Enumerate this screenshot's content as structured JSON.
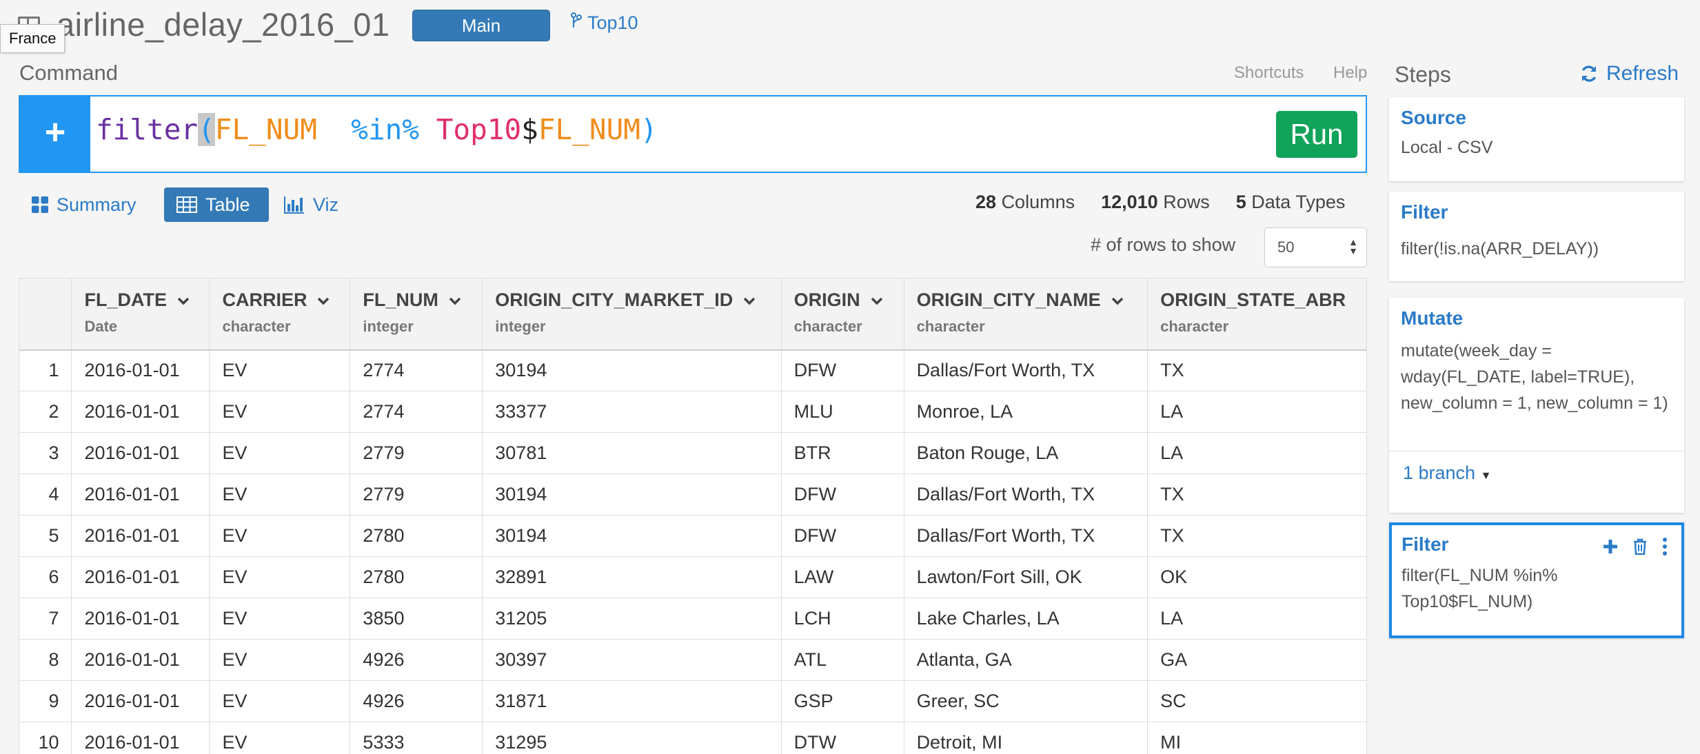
{
  "header": {
    "title": "airline_delay_2016_01",
    "tooltip": "France",
    "main_button": "Main",
    "branch_link": "Top10"
  },
  "command": {
    "label": "Command",
    "shortcuts": "Shortcuts",
    "help": "Help",
    "add_symbol": "+",
    "code": {
      "fn": "filter",
      "open": "(",
      "col1": "FL_NUM",
      "op": "%in%",
      "var": "Top10",
      "dollar": "$",
      "col2": "FL_NUM",
      "close": ")"
    },
    "run": "Run"
  },
  "tabs": [
    {
      "label": "Summary",
      "icon": "grid-icon",
      "active": false
    },
    {
      "label": "Table",
      "icon": "table-icon",
      "active": true
    },
    {
      "label": "Viz",
      "icon": "bar-chart-icon",
      "active": false
    }
  ],
  "stats": {
    "columns_count": "28",
    "columns_label": "Columns",
    "rows_count": "12,010",
    "rows_label": "Rows",
    "types_count": "5",
    "types_label": "Data Types"
  },
  "rows_to_show": {
    "label": "# of rows to show",
    "value": "50"
  },
  "table": {
    "columns": [
      {
        "name": "FL_DATE",
        "type": "Date"
      },
      {
        "name": "CARRIER",
        "type": "character"
      },
      {
        "name": "FL_NUM",
        "type": "integer"
      },
      {
        "name": "ORIGIN_CITY_MARKET_ID",
        "type": "integer"
      },
      {
        "name": "ORIGIN",
        "type": "character"
      },
      {
        "name": "ORIGIN_CITY_NAME",
        "type": "character"
      },
      {
        "name": "ORIGIN_STATE_ABR",
        "type": "character"
      }
    ],
    "rows": [
      [
        "1",
        "2016-01-01",
        "EV",
        "2774",
        "30194",
        "DFW",
        "Dallas/Fort Worth, TX",
        "TX"
      ],
      [
        "2",
        "2016-01-01",
        "EV",
        "2774",
        "33377",
        "MLU",
        "Monroe, LA",
        "LA"
      ],
      [
        "3",
        "2016-01-01",
        "EV",
        "2779",
        "30781",
        "BTR",
        "Baton Rouge, LA",
        "LA"
      ],
      [
        "4",
        "2016-01-01",
        "EV",
        "2779",
        "30194",
        "DFW",
        "Dallas/Fort Worth, TX",
        "TX"
      ],
      [
        "5",
        "2016-01-01",
        "EV",
        "2780",
        "30194",
        "DFW",
        "Dallas/Fort Worth, TX",
        "TX"
      ],
      [
        "6",
        "2016-01-01",
        "EV",
        "2780",
        "32891",
        "LAW",
        "Lawton/Fort Sill, OK",
        "OK"
      ],
      [
        "7",
        "2016-01-01",
        "EV",
        "3850",
        "31205",
        "LCH",
        "Lake Charles, LA",
        "LA"
      ],
      [
        "8",
        "2016-01-01",
        "EV",
        "4926",
        "30397",
        "ATL",
        "Atlanta, GA",
        "GA"
      ],
      [
        "9",
        "2016-01-01",
        "EV",
        "4926",
        "31871",
        "GSP",
        "Greer, SC",
        "SC"
      ],
      [
        "10",
        "2016-01-01",
        "EV",
        "5333",
        "31295",
        "DTW",
        "Detroit, MI",
        "MI"
      ]
    ]
  },
  "steps": {
    "title": "Steps",
    "refresh": "Refresh",
    "items": [
      {
        "title": "Source",
        "body": "Local - CSV"
      },
      {
        "title": "Filter",
        "body": "filter(!is.na(ARR_DELAY))"
      },
      {
        "title": "Mutate",
        "body": "mutate(week_day = wday(FL_DATE, label=TRUE), new_column = 1, new_column = 1)",
        "branch": "1 branch"
      },
      {
        "title": "Filter",
        "body": "filter(FL_NUM %in% Top10$FL_NUM)"
      }
    ]
  },
  "colors": {
    "primary": "#337ab7",
    "accent_blue": "#2196f3",
    "link": "#2b7bc8",
    "run_green": "#10a359"
  }
}
